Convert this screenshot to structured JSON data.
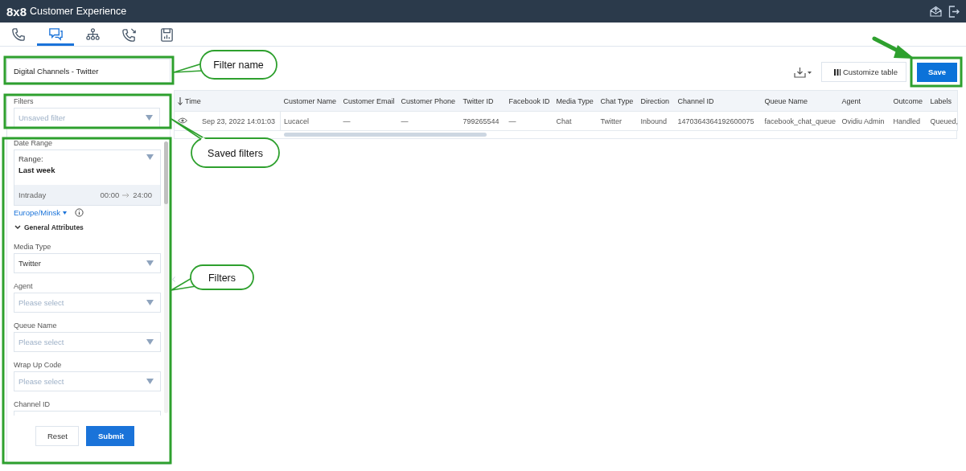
{
  "header": {
    "logo": "8x8",
    "title": "Customer Experience"
  },
  "nav_tabs": [
    {
      "kind": "phone",
      "selected": false
    },
    {
      "kind": "chat",
      "selected": true
    },
    {
      "kind": "hierarchy",
      "selected": false
    },
    {
      "kind": "callback",
      "selected": false
    },
    {
      "kind": "report",
      "selected": false
    }
  ],
  "filter_name": {
    "value": "Digital Channels - Twitter"
  },
  "saved_filters": {
    "label": "Filters",
    "placeholder": "Unsaved filter"
  },
  "date_range": {
    "label": "Date Range",
    "range_label": "Range:",
    "range_value": "Last week",
    "intraday": "Intraday",
    "from": "00:00",
    "to": "24:00",
    "timezone": "Europe/Minsk"
  },
  "section": {
    "title": "General Attributes",
    "expanded": true
  },
  "fields": [
    {
      "label": "Media Type",
      "value": "Twitter"
    },
    {
      "label": "Agent",
      "placeholder": "Please select"
    },
    {
      "label": "Queue Name",
      "placeholder": "Please select"
    },
    {
      "label": "Wrap Up Code",
      "placeholder": "Please select"
    },
    {
      "label": "Channel ID"
    }
  ],
  "buttons": {
    "reset": "Reset",
    "submit": "Submit"
  },
  "toolbar": {
    "customize": "Customize table",
    "save": "Save"
  },
  "table": {
    "columns": [
      {
        "label": "Time",
        "sorted": true
      },
      {
        "label": "Customer Name",
        "sorted": false
      },
      {
        "label": "Customer Email",
        "sorted": false
      },
      {
        "label": "Customer Phone",
        "sorted": false
      },
      {
        "label": "Twitter ID",
        "sorted": false
      },
      {
        "label": "Facebook ID",
        "sorted": false
      },
      {
        "label": "Media Type",
        "sorted": false
      },
      {
        "label": "Chat Type",
        "sorted": false
      },
      {
        "label": "Direction",
        "sorted": false
      },
      {
        "label": "Channel ID",
        "sorted": false
      },
      {
        "label": "Queue Name",
        "sorted": false
      },
      {
        "label": "Agent",
        "sorted": false
      },
      {
        "label": "Outcome",
        "sorted": false
      },
      {
        "label": "Labels",
        "sorted": false
      }
    ],
    "rows": [
      [
        "Sep 23, 2022 14:01:03",
        "Lucacel",
        "—",
        "—",
        "799265544",
        "—",
        "Chat",
        "Twitter",
        "Inbound",
        "1470364364192600075",
        "facebook_chat_queue",
        "Ovidiu Admin",
        "Handled",
        "Queued,"
      ]
    ]
  },
  "callouts": [
    {
      "text": "Filter name"
    },
    {
      "text": "Saved filters"
    },
    {
      "text": "Filters"
    }
  ]
}
